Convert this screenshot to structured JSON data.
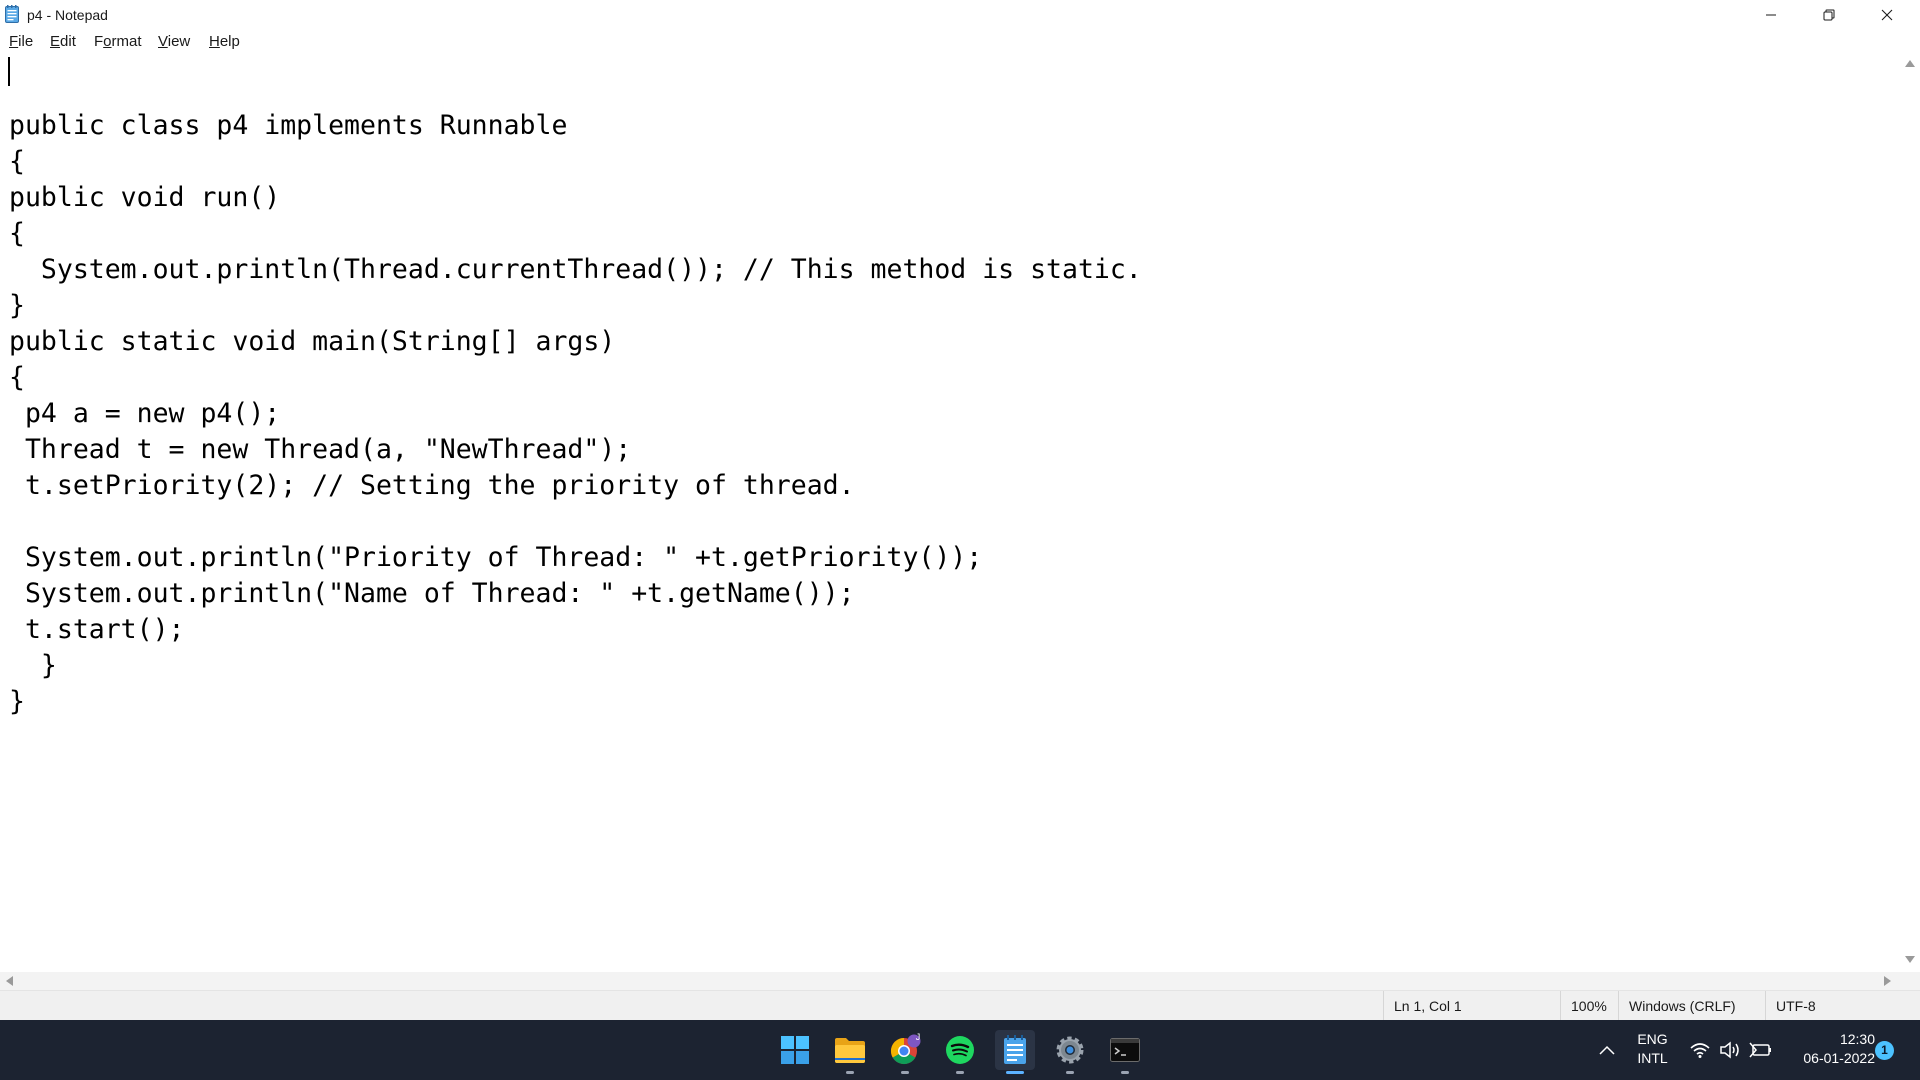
{
  "window": {
    "title": "p4 - Notepad",
    "app_icon": "notepad-icon"
  },
  "menu": {
    "file": {
      "mnemonic": "F",
      "rest": "ile"
    },
    "edit": {
      "mnemonic": "E",
      "rest": "dit"
    },
    "format": {
      "before": "F",
      "mnemonic": "o",
      "rest": "rmat"
    },
    "view": {
      "mnemonic": "V",
      "rest": "iew"
    },
    "help": {
      "mnemonic": "H",
      "rest": "elp"
    }
  },
  "editor": {
    "lines": [
      "public class p4 implements Runnable",
      "{",
      "public void run()",
      "{",
      "  System.out.println(Thread.currentThread()); // This method is static.",
      "}",
      "public static void main(String[] args)",
      "{",
      " p4 a = new p4();",
      " Thread t = new Thread(a, \"NewThread\");",
      " t.setPriority(2); // Setting the priority of thread.",
      "",
      " System.out.println(\"Priority of Thread: \" +t.getPriority());",
      " System.out.println(\"Name of Thread: \" +t.getName());",
      " t.start();",
      "  }",
      "}"
    ]
  },
  "status": {
    "position": "Ln 1, Col 1",
    "zoom": "100%",
    "line_ending": "Windows (CRLF)",
    "encoding": "UTF-8"
  },
  "taskbar": {
    "apps": [
      "start-icon",
      "file-explorer-icon",
      "chrome-icon",
      "spotify-icon",
      "notepad-icon",
      "settings-icon",
      "terminal-icon"
    ],
    "language_top": "ENG",
    "language_bottom": "INTL",
    "time": "12:30",
    "date": "06-01-2022",
    "notifications": "1",
    "chrome_badge": "J",
    "colors": {
      "taskbar_bg": "#1c2331",
      "accent": "#5cb2ff",
      "spotify": "#1ed760"
    }
  }
}
